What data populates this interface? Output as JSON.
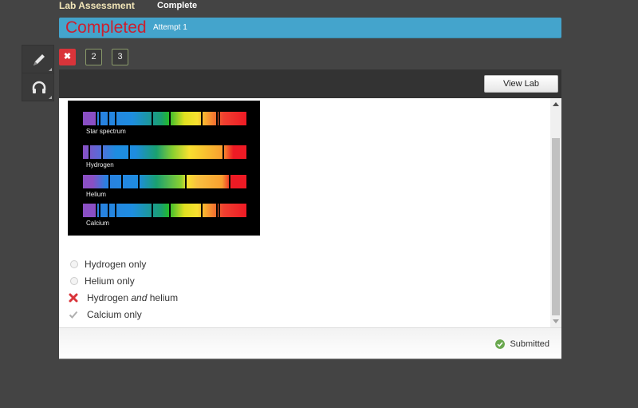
{
  "header": {
    "title": "Lab Assessment",
    "status": "Complete"
  },
  "banner": {
    "status": "Completed",
    "attempt": "Attempt 1",
    "color": "#44a4cc",
    "status_color": "#cc1f2e"
  },
  "side_tools": [
    {
      "icon": "pencil-icon"
    },
    {
      "icon": "headphones-icon"
    }
  ],
  "question_nav": [
    {
      "label": "✖",
      "state": "incorrect"
    },
    {
      "label": "2",
      "state": "unanswered"
    },
    {
      "label": "3",
      "state": "unanswered"
    }
  ],
  "panel": {
    "view_lab_label": "View Lab"
  },
  "figure": {
    "spectra": [
      {
        "label": "Star spectrum"
      },
      {
        "label": "Hydrogen"
      },
      {
        "label": "Helium"
      },
      {
        "label": "Calcium"
      }
    ]
  },
  "options": [
    {
      "text_a": "Hydrogen only",
      "state": "unselected"
    },
    {
      "text_a": "Helium only",
      "state": "unselected"
    },
    {
      "text_a": "Hydrogen ",
      "text_em": "and",
      "text_b": " helium",
      "state": "selected-incorrect"
    },
    {
      "text_a": "Calcium only",
      "state": "correct-answer"
    }
  ],
  "footer": {
    "status": "Submitted"
  }
}
